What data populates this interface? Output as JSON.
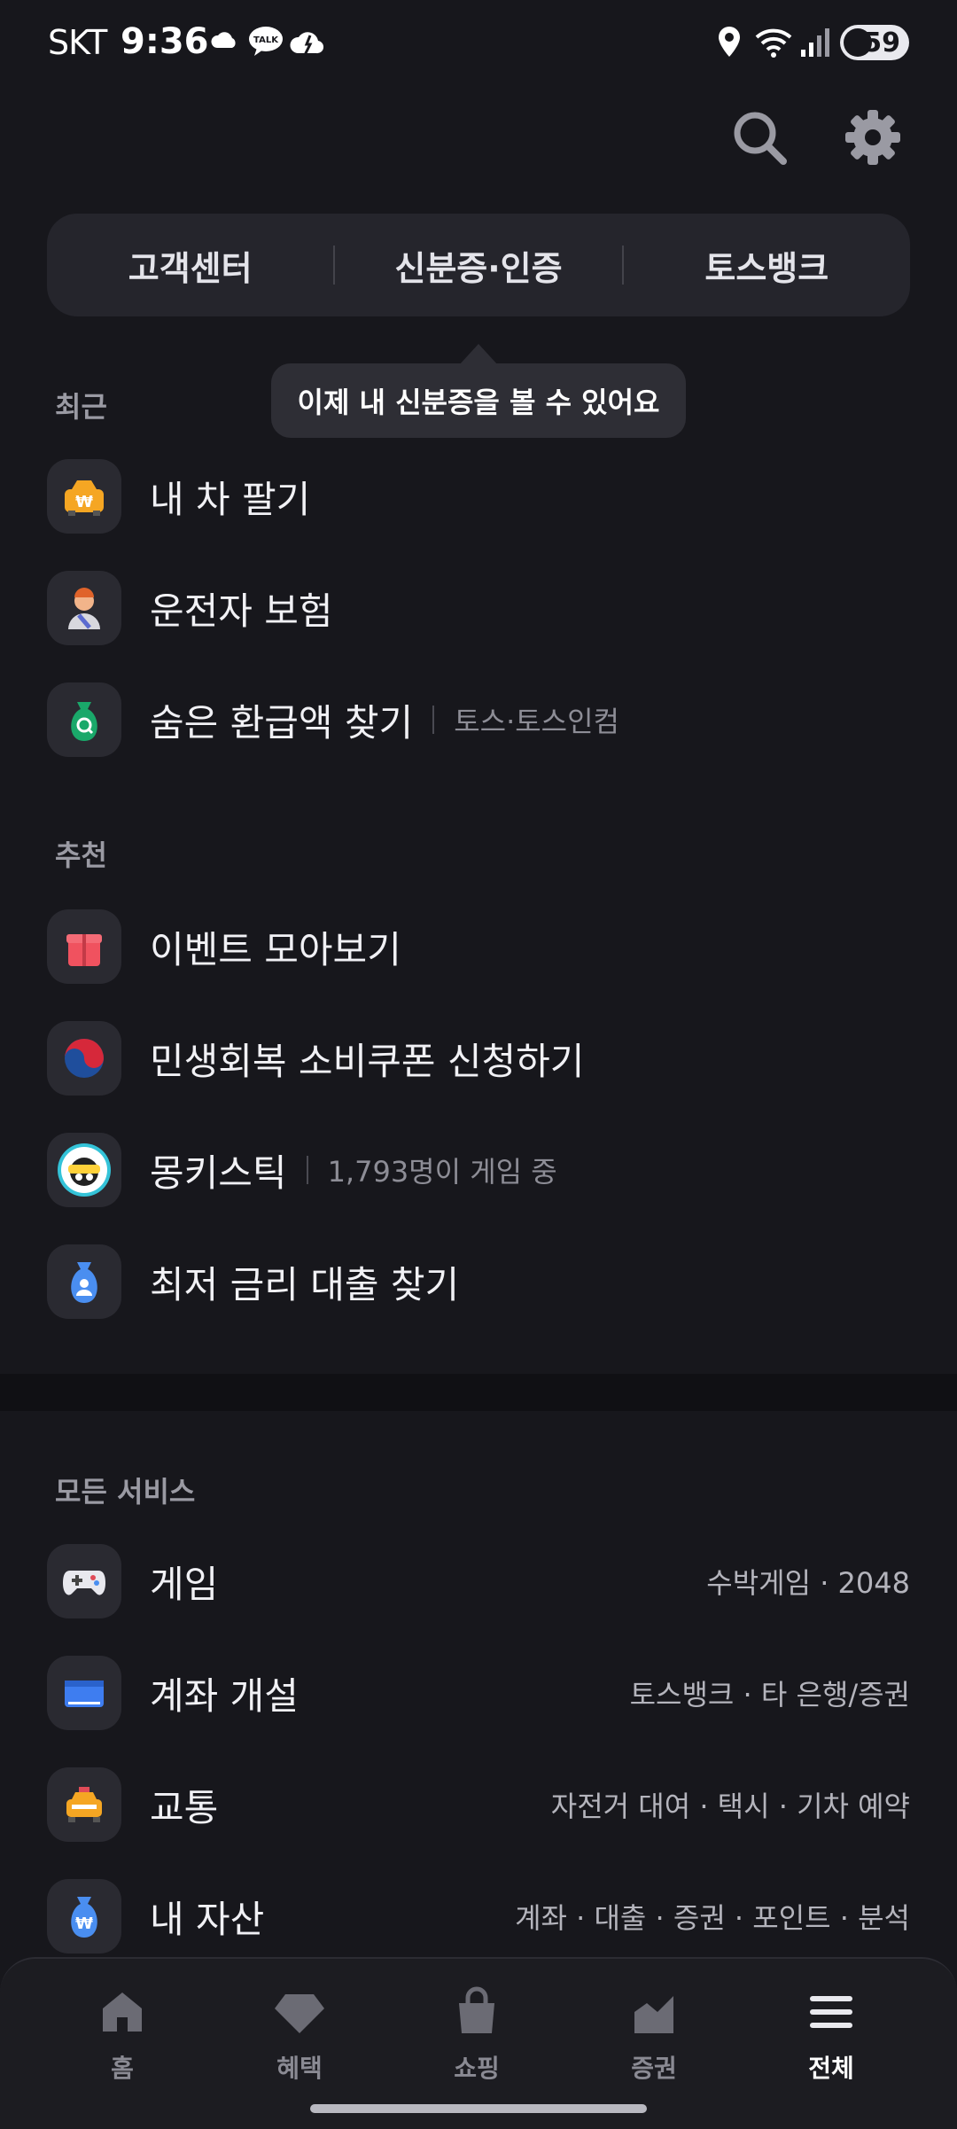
{
  "status_bar": {
    "carrier": "SKT",
    "time": "9:36",
    "battery": "59",
    "icons": [
      "cloud-icon",
      "talk-icon",
      "cloud-icon",
      "location-icon",
      "wifi-icon",
      "signal-icon",
      "battery-icon"
    ]
  },
  "top_actions": [
    "search-icon",
    "gear-icon"
  ],
  "segments": [
    "고객센터",
    "신분증·인증",
    "토스뱅크"
  ],
  "tooltip": "이제 내 신분증을 볼 수 있어요",
  "recent": {
    "title": "최근",
    "items": [
      {
        "label": "내 차 팔기",
        "icon": "car-won-icon"
      },
      {
        "label": "운전자 보험",
        "icon": "driver-icon"
      },
      {
        "label": "숨은 환급액 찾기",
        "sub": "토스·토스인컴",
        "icon": "money-bag-search-icon"
      }
    ]
  },
  "recommend": {
    "title": "추천",
    "items": [
      {
        "label": "이벤트 모아보기",
        "icon": "gift-icon"
      },
      {
        "label": "민생회복 소비쿠폰 신청하기",
        "icon": "taegeuk-icon"
      },
      {
        "label": "몽키스틱",
        "sub": "1,793명이 게임 중",
        "icon": "monkey-icon"
      },
      {
        "label": "최저 금리 대출 찾기",
        "icon": "loan-bag-icon"
      }
    ]
  },
  "all_services": {
    "title": "모든 서비스",
    "items": [
      {
        "label": "게임",
        "right": "수박게임 · 2048",
        "icon": "gamepad-icon"
      },
      {
        "label": "계좌 개설",
        "right": "토스뱅크 · 타 은행/증권",
        "icon": "card-icon"
      },
      {
        "label": "교통",
        "right": "자전거 대여 · 택시 · 기차 예약",
        "icon": "taxi-icon"
      },
      {
        "label": "내 자산",
        "right": "계좌 · 대출 · 증권 · 포인트 · 분석",
        "icon": "won-bag-icon"
      }
    ]
  },
  "bottom_nav": [
    {
      "label": "홈",
      "icon": "home-icon"
    },
    {
      "label": "혜택",
      "icon": "diamond-icon"
    },
    {
      "label": "쇼핑",
      "icon": "shopping-bag-icon"
    },
    {
      "label": "증권",
      "icon": "chart-icon"
    },
    {
      "label": "전체",
      "icon": "menu-icon",
      "active": true
    }
  ]
}
